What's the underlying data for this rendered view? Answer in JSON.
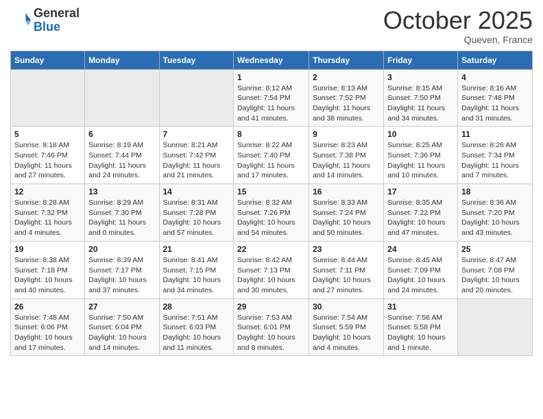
{
  "header": {
    "logo_general": "General",
    "logo_blue": "Blue",
    "month_title": "October 2025",
    "location": "Queven, France"
  },
  "calendar": {
    "days_of_week": [
      "Sunday",
      "Monday",
      "Tuesday",
      "Wednesday",
      "Thursday",
      "Friday",
      "Saturday"
    ],
    "weeks": [
      [
        {
          "day": "",
          "info": ""
        },
        {
          "day": "",
          "info": ""
        },
        {
          "day": "",
          "info": ""
        },
        {
          "day": "1",
          "info": "Sunrise: 8:12 AM\nSunset: 7:54 PM\nDaylight: 11 hours and 41 minutes."
        },
        {
          "day": "2",
          "info": "Sunrise: 8:13 AM\nSunset: 7:52 PM\nDaylight: 11 hours and 38 minutes."
        },
        {
          "day": "3",
          "info": "Sunrise: 8:15 AM\nSunset: 7:50 PM\nDaylight: 11 hours and 34 minutes."
        },
        {
          "day": "4",
          "info": "Sunrise: 8:16 AM\nSunset: 7:48 PM\nDaylight: 11 hours and 31 minutes."
        }
      ],
      [
        {
          "day": "5",
          "info": "Sunrise: 8:18 AM\nSunset: 7:46 PM\nDaylight: 11 hours and 27 minutes."
        },
        {
          "day": "6",
          "info": "Sunrise: 8:19 AM\nSunset: 7:44 PM\nDaylight: 11 hours and 24 minutes."
        },
        {
          "day": "7",
          "info": "Sunrise: 8:21 AM\nSunset: 7:42 PM\nDaylight: 11 hours and 21 minutes."
        },
        {
          "day": "8",
          "info": "Sunrise: 8:22 AM\nSunset: 7:40 PM\nDaylight: 11 hours and 17 minutes."
        },
        {
          "day": "9",
          "info": "Sunrise: 8:23 AM\nSunset: 7:38 PM\nDaylight: 11 hours and 14 minutes."
        },
        {
          "day": "10",
          "info": "Sunrise: 8:25 AM\nSunset: 7:36 PM\nDaylight: 11 hours and 10 minutes."
        },
        {
          "day": "11",
          "info": "Sunrise: 8:26 AM\nSunset: 7:34 PM\nDaylight: 11 hours and 7 minutes."
        }
      ],
      [
        {
          "day": "12",
          "info": "Sunrise: 8:28 AM\nSunset: 7:32 PM\nDaylight: 11 hours and 4 minutes."
        },
        {
          "day": "13",
          "info": "Sunrise: 8:29 AM\nSunset: 7:30 PM\nDaylight: 11 hours and 0 minutes."
        },
        {
          "day": "14",
          "info": "Sunrise: 8:31 AM\nSunset: 7:28 PM\nDaylight: 10 hours and 57 minutes."
        },
        {
          "day": "15",
          "info": "Sunrise: 8:32 AM\nSunset: 7:26 PM\nDaylight: 10 hours and 54 minutes."
        },
        {
          "day": "16",
          "info": "Sunrise: 8:33 AM\nSunset: 7:24 PM\nDaylight: 10 hours and 50 minutes."
        },
        {
          "day": "17",
          "info": "Sunrise: 8:35 AM\nSunset: 7:22 PM\nDaylight: 10 hours and 47 minutes."
        },
        {
          "day": "18",
          "info": "Sunrise: 8:36 AM\nSunset: 7:20 PM\nDaylight: 10 hours and 43 minutes."
        }
      ],
      [
        {
          "day": "19",
          "info": "Sunrise: 8:38 AM\nSunset: 7:18 PM\nDaylight: 10 hours and 40 minutes."
        },
        {
          "day": "20",
          "info": "Sunrise: 8:39 AM\nSunset: 7:17 PM\nDaylight: 10 hours and 37 minutes."
        },
        {
          "day": "21",
          "info": "Sunrise: 8:41 AM\nSunset: 7:15 PM\nDaylight: 10 hours and 34 minutes."
        },
        {
          "day": "22",
          "info": "Sunrise: 8:42 AM\nSunset: 7:13 PM\nDaylight: 10 hours and 30 minutes."
        },
        {
          "day": "23",
          "info": "Sunrise: 8:44 AM\nSunset: 7:11 PM\nDaylight: 10 hours and 27 minutes."
        },
        {
          "day": "24",
          "info": "Sunrise: 8:45 AM\nSunset: 7:09 PM\nDaylight: 10 hours and 24 minutes."
        },
        {
          "day": "25",
          "info": "Sunrise: 8:47 AM\nSunset: 7:08 PM\nDaylight: 10 hours and 20 minutes."
        }
      ],
      [
        {
          "day": "26",
          "info": "Sunrise: 7:48 AM\nSunset: 6:06 PM\nDaylight: 10 hours and 17 minutes."
        },
        {
          "day": "27",
          "info": "Sunrise: 7:50 AM\nSunset: 6:04 PM\nDaylight: 10 hours and 14 minutes."
        },
        {
          "day": "28",
          "info": "Sunrise: 7:51 AM\nSunset: 6:03 PM\nDaylight: 10 hours and 11 minutes."
        },
        {
          "day": "29",
          "info": "Sunrise: 7:53 AM\nSunset: 6:01 PM\nDaylight: 10 hours and 8 minutes."
        },
        {
          "day": "30",
          "info": "Sunrise: 7:54 AM\nSunset: 5:59 PM\nDaylight: 10 hours and 4 minutes."
        },
        {
          "day": "31",
          "info": "Sunrise: 7:56 AM\nSunset: 5:58 PM\nDaylight: 10 hours and 1 minute."
        },
        {
          "day": "",
          "info": ""
        }
      ]
    ]
  }
}
